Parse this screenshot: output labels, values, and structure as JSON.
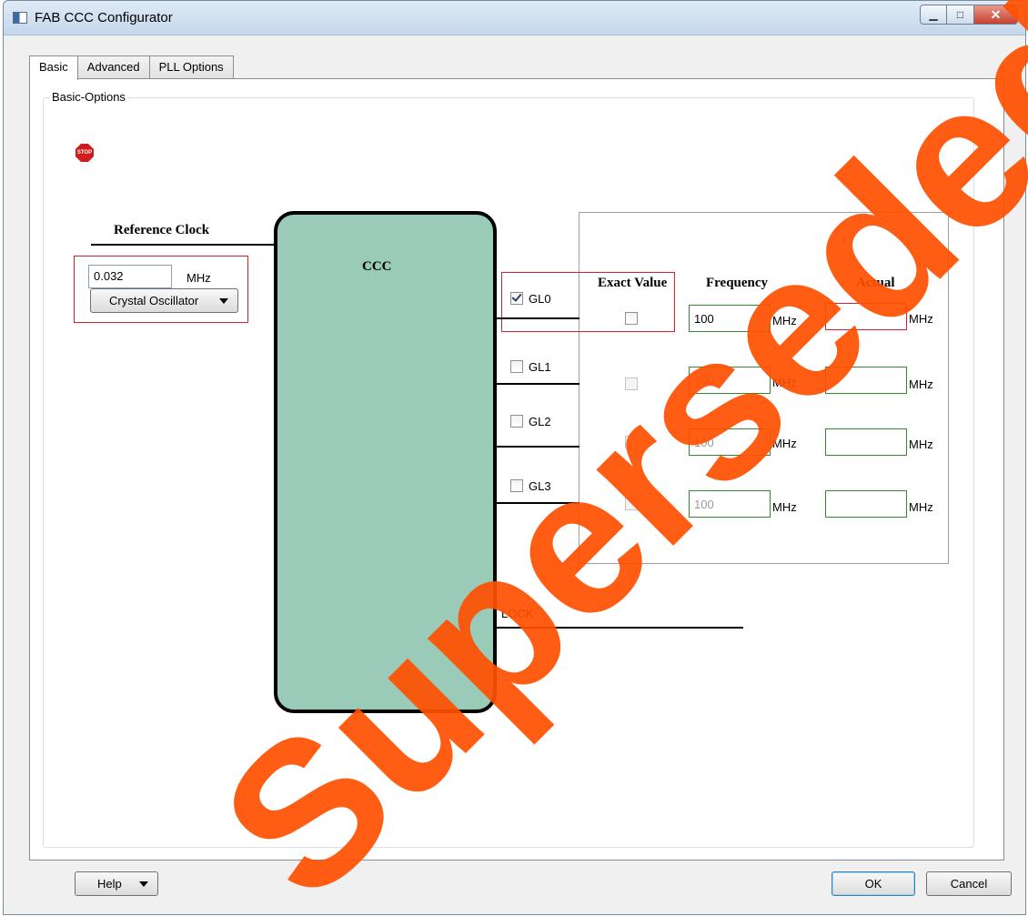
{
  "window": {
    "title": "FAB CCC Configurator"
  },
  "tabs": [
    {
      "label": "Basic",
      "active": true
    },
    {
      "label": "Advanced",
      "active": false
    },
    {
      "label": "PLL Options",
      "active": false
    }
  ],
  "basic_options": {
    "group_title": "Basic-Options",
    "stop_icon_text": "STOP",
    "reference_clock": {
      "label": "Reference Clock",
      "value": "0.032",
      "unit": "MHz",
      "source": "Crystal Oscillator"
    },
    "ccc_label": "CCC",
    "columns": {
      "exact_value": "Exact Value",
      "frequency": "Frequency",
      "actual": "Actual"
    },
    "outputs": [
      {
        "name": "GL0",
        "enabled": true,
        "exact_value": false,
        "frequency": "100",
        "freq_unit": "MHz",
        "actual": "",
        "actual_unit": "MHz",
        "actual_error": true
      },
      {
        "name": "GL1",
        "enabled": false,
        "exact_value": false,
        "frequency": "100",
        "freq_unit": "MHz",
        "actual": "",
        "actual_unit": "MHz",
        "actual_error": false
      },
      {
        "name": "GL2",
        "enabled": false,
        "exact_value": false,
        "frequency": "100",
        "freq_unit": "MHz",
        "actual": "",
        "actual_unit": "MHz",
        "actual_error": false
      },
      {
        "name": "GL3",
        "enabled": false,
        "exact_value": false,
        "frequency": "100",
        "freq_unit": "MHz",
        "actual": "",
        "actual_unit": "MHz",
        "actual_error": false
      }
    ],
    "lock_label": "LOCK"
  },
  "footer": {
    "help_label": "Help",
    "ok_label": "OK",
    "cancel_label": "Cancel"
  },
  "watermark": {
    "text": "Superseded",
    "color": "#ff4f00"
  },
  "colors": {
    "error_border": "#d2232a",
    "valid_border": "#2f8a2f",
    "ccc_fill": "#9acbb9"
  }
}
